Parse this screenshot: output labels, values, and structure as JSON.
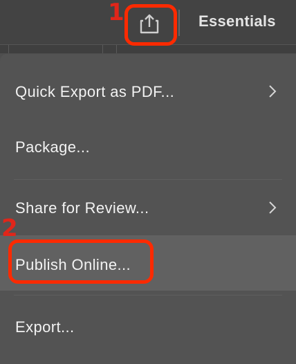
{
  "toolbar": {
    "share_icon": "share-export-icon",
    "workspace_label": "Essentials"
  },
  "menu": {
    "items": [
      {
        "label": "Quick Export as PDF...",
        "has_submenu": true
      },
      {
        "label": "Package...",
        "has_submenu": false
      },
      {
        "label": "Share for Review...",
        "has_submenu": true
      },
      {
        "label": "Publish Online...",
        "has_submenu": false,
        "highlighted": true
      },
      {
        "label": "Export...",
        "has_submenu": false
      }
    ],
    "chevron_icon": "chevron-right-icon"
  },
  "annotations": {
    "step1": "1",
    "step2": "2",
    "color": "#ff2a00"
  }
}
